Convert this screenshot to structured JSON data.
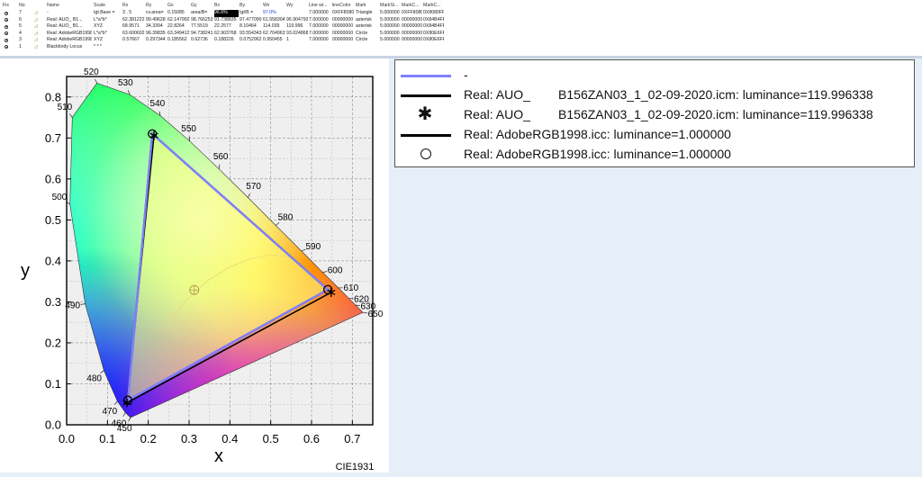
{
  "table": {
    "headers": [
      "Fix",
      "No",
      "",
      "Name",
      "Scale",
      "Rx",
      "Ry",
      "Gx",
      "Gy",
      "Bx",
      "By",
      "Wx",
      "Wy",
      "Line wi...",
      "lineColor",
      "Mark",
      "MarkSi...",
      "MarkC...",
      "MarkC..."
    ],
    "rows": [
      {
        "no": "7",
        "name": "-",
        "scale": "tgt.Base =",
        "rx": "3 . 5",
        "ry": "cv.area=",
        "gx": "0.15085",
        "gy": "area/B=",
        "bx": "96.6%",
        "by": "tgt/B =",
        "wx": "97.0%",
        "wy": "",
        "linewidth": "7.000000",
        "linecolor": "0XFF8080",
        "mark": "Triangle",
        "marksize": "5.000000",
        "markc1": "0XFF8080",
        "markc2": "0X8080FF"
      },
      {
        "no": "6",
        "name": "Real: AUO_        B1...",
        "scale": "L*a*b*",
        "rx": "62.381222",
        "ry": "99.496283",
        "gx": "62.147992",
        "gy": "98.766253",
        "bx": "91.738835",
        "by": "97.477090",
        "wx": "61.558304",
        "wy": "96.904793",
        "linewidth": "7.000000",
        "linecolor": "00000000",
        "mark": "asterisk",
        "marksize": "5.000000",
        "markc1": "00000000",
        "markc2": "0X84B4FF"
      },
      {
        "no": "5",
        "name": "Real: AUO_        B1...",
        "scale": "XYZ",
        "rx": "68.9571",
        "ry": "34.3394",
        "gx": "22.8264",
        "gy": "77.5519",
        "bx": "22.2577",
        "by": "8.10464",
        "wx": "114.039",
        "wy": "119.996",
        "linewidth": "7.000000",
        "linecolor": "00000000",
        "mark": "asterisk",
        "marksize": "5.000000",
        "markc1": "00000000",
        "markc2": "0X84B4FF"
      },
      {
        "no": "4",
        "name": "Real: AdobeRGB1998...",
        "scale": "L*a*b*",
        "rx": "63.600602",
        "ry": "96.398358",
        "gx": "63.349412",
        "gy": "94.738241",
        "bx": "62.903768",
        "by": "93.554343",
        "wx": "62.704963",
        "wy": "93.024868",
        "linewidth": "7.000000",
        "linecolor": "00000000",
        "mark": "Circle",
        "marksize": "5.000000",
        "markc1": "00000000",
        "markc2": "0X80E6FF"
      },
      {
        "no": "3",
        "name": "Real: AdobeRGB1998...",
        "scale": "XYZ",
        "rx": "0.57667",
        "ry": "0.297344",
        "gx": "0.185562",
        "gy": "0.62736",
        "bx": "0.188226",
        "by": "0.0752962",
        "wx": "0.950455",
        "wy": "1",
        "linewidth": "7.000000",
        "linecolor": "00000000",
        "mark": "Circle",
        "marksize": "5.000000",
        "markc1": "00000000",
        "markc2": "0X80E6FF"
      },
      {
        "no": "1",
        "name": "Blackbody Locus",
        "scale": "* * *",
        "rx": "",
        "ry": "",
        "gx": "",
        "gy": "",
        "bx": "",
        "by": "",
        "wx": "",
        "wy": "",
        "linewidth": "",
        "linecolor": "",
        "mark": "",
        "marksize": "",
        "markc1": "",
        "markc2": ""
      }
    ]
  },
  "chart_data": {
    "type": "scatter",
    "title": "CIE1931",
    "xlabel": "x",
    "ylabel": "y",
    "xlim": [
      0.0,
      0.75
    ],
    "ylim": [
      0.0,
      0.85
    ],
    "x_ticks": [
      "0.0",
      "0.1",
      "0.2",
      "0.3",
      "0.4",
      "0.5",
      "0.6",
      "0.7"
    ],
    "y_ticks": [
      "0.0",
      "0.1",
      "0.2",
      "0.3",
      "0.4",
      "0.5",
      "0.6",
      "0.7",
      "0.8"
    ],
    "grid": true,
    "spectral_locus": [
      {
        "nm": "450",
        "x": 0.1566,
        "y": 0.0177
      },
      {
        "nm": "460",
        "x": 0.144,
        "y": 0.0297
      },
      {
        "nm": "470",
        "x": 0.1241,
        "y": 0.0578
      },
      {
        "nm": "480",
        "x": 0.0913,
        "y": 0.1327
      },
      {
        "nm": "490",
        "x": 0.0454,
        "y": 0.295
      },
      {
        "nm": "500",
        "x": 0.0082,
        "y": 0.5384
      },
      {
        "nm": "510",
        "x": 0.0139,
        "y": 0.7502
      },
      {
        "nm": "520",
        "x": 0.0743,
        "y": 0.8338
      },
      {
        "nm": "530",
        "x": 0.1547,
        "y": 0.8059
      },
      {
        "nm": "540",
        "x": 0.2296,
        "y": 0.7543
      },
      {
        "nm": "550",
        "x": 0.3016,
        "y": 0.6923
      },
      {
        "nm": "560",
        "x": 0.3731,
        "y": 0.6245
      },
      {
        "nm": "570",
        "x": 0.4441,
        "y": 0.5547
      },
      {
        "nm": "580",
        "x": 0.5125,
        "y": 0.4866
      },
      {
        "nm": "590",
        "x": 0.5752,
        "y": 0.4242
      },
      {
        "nm": "600",
        "x": 0.627,
        "y": 0.3725
      },
      {
        "nm": "610",
        "x": 0.6658,
        "y": 0.334
      },
      {
        "nm": "620",
        "x": 0.6915,
        "y": 0.3083
      },
      {
        "nm": "630",
        "x": 0.7079,
        "y": 0.292
      },
      {
        "nm": "650",
        "x": 0.726,
        "y": 0.274
      }
    ],
    "series": [
      {
        "name": "-",
        "color": "#8080ff",
        "points": [
          {
            "x": 0.64,
            "y": 0.33
          },
          {
            "x": 0.21,
            "y": 0.71
          },
          {
            "x": 0.15,
            "y": 0.06
          }
        ]
      },
      {
        "name": "Real: AUO_        B156ZAN03_1_02-09-2020.icm: luminance=119.996338",
        "color": "#000000",
        "points": [
          {
            "x": 0.648,
            "y": 0.323
          },
          {
            "x": 0.214,
            "y": 0.706
          },
          {
            "x": 0.148,
            "y": 0.054
          }
        ],
        "marker": "asterisk"
      },
      {
        "name": "Real: AdobeRGB1998.icc: luminance=1.000000",
        "color": "#000000",
        "points": [
          {
            "x": 0.64,
            "y": 0.33
          },
          {
            "x": 0.21,
            "y": 0.71
          },
          {
            "x": 0.15,
            "y": 0.06
          }
        ],
        "marker": "circle"
      }
    ],
    "white_point": {
      "x": 0.3127,
      "y": 0.329
    },
    "blackbody_label": "Blackbody Locus"
  },
  "legend": {
    "entries": [
      {
        "label": "-",
        "type": "line",
        "color": "#8080ff"
      },
      {
        "label": "Real: AUO_        B156ZAN03_1_02-09-2020.icm: luminance=119.996338",
        "type": "line",
        "color": "#000000"
      },
      {
        "label": "Real: AUO_        B156ZAN03_1_02-09-2020.icm: luminance=119.996338",
        "type": "asterisk",
        "color": "#000000"
      },
      {
        "label": "Real: AdobeRGB1998.icc: luminance=1.000000",
        "type": "line",
        "color": "#000000"
      },
      {
        "label": "Real: AdobeRGB1998.icc: luminance=1.000000",
        "type": "circle",
        "color": "#000000"
      }
    ]
  }
}
